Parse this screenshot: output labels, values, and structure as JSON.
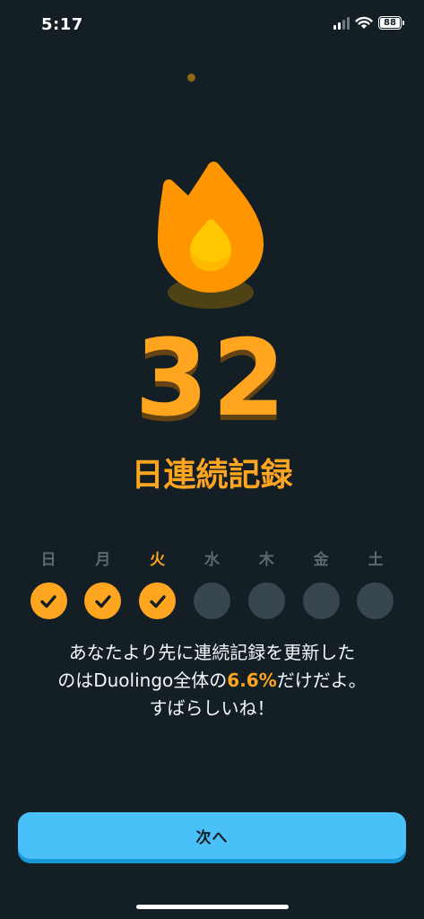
{
  "status_bar": {
    "time": "5:17",
    "battery_level": "88"
  },
  "streak": {
    "count": "32",
    "label": "日連続記録"
  },
  "week": {
    "days": [
      {
        "label": "日",
        "completed": true,
        "today": false
      },
      {
        "label": "月",
        "completed": true,
        "today": false
      },
      {
        "label": "火",
        "completed": true,
        "today": true
      },
      {
        "label": "水",
        "completed": false,
        "today": false
      },
      {
        "label": "木",
        "completed": false,
        "today": false
      },
      {
        "label": "金",
        "completed": false,
        "today": false
      },
      {
        "label": "土",
        "completed": false,
        "today": false
      }
    ]
  },
  "message": {
    "line1": "あなたより先に連続記録を更新した",
    "line2_pre": "のはDuolingo全体の",
    "percent": "6.6%",
    "line2_post": "だけだよ。",
    "line3": "すばらしいね！"
  },
  "next_button": {
    "label": "次へ"
  },
  "colors": {
    "background": "#131f24",
    "accent_orange": "#ffa51f",
    "button_blue": "#49c0f8",
    "inactive_circle": "#37464f"
  },
  "icons": {
    "flame": "flame-icon",
    "check": "check-icon",
    "signal": "signal-icon",
    "wifi": "wifi-icon",
    "battery": "battery-icon"
  }
}
